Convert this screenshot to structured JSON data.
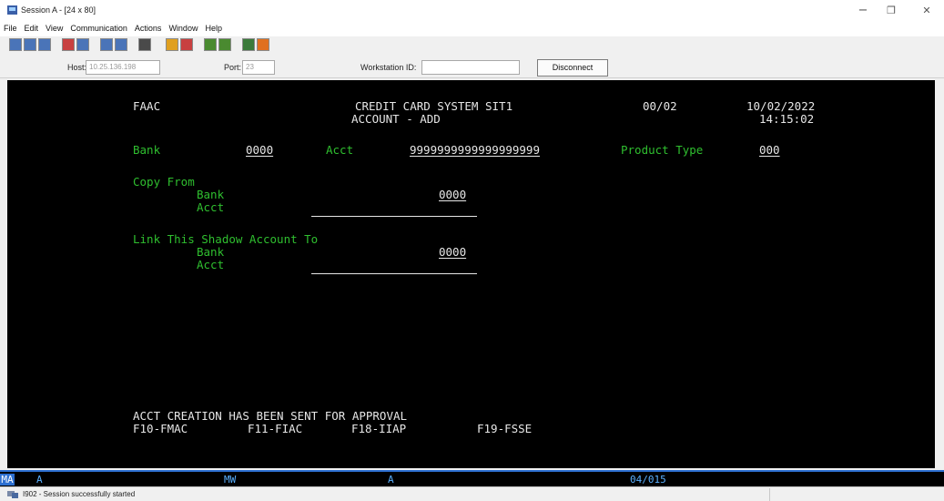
{
  "window": {
    "title": "Session A - [24 x 80]",
    "controls": {
      "minimize": "−",
      "restore": "❐",
      "close": "✕"
    }
  },
  "menu": [
    "File",
    "Edit",
    "View",
    "Communication",
    "Actions",
    "Window",
    "Help"
  ],
  "toolbar": {
    "buttons": [
      {
        "icon": "display-icon",
        "color": "#4a74b8"
      },
      {
        "icon": "copy-icon",
        "color": "#4a74b8"
      },
      {
        "icon": "paste-icon",
        "color": "#4a74b8"
      },
      {
        "icon": "send-icon",
        "color": "#c84040"
      },
      {
        "icon": "receive-icon",
        "color": "#4a74b8"
      },
      {
        "icon": "keypad-icon",
        "color": "#4a74b8"
      },
      {
        "icon": "keyboard-map-icon",
        "color": "#4a74b8"
      },
      {
        "icon": "record-icon",
        "color": "#4a4a4a"
      },
      {
        "icon": "macro-play-icon",
        "color": "#e0a020"
      },
      {
        "icon": "macro-record-icon",
        "color": "#c84040"
      },
      {
        "icon": "chart-icon",
        "color": "#4a8a30"
      },
      {
        "icon": "script-icon",
        "color": "#4a8a30"
      },
      {
        "icon": "globe-icon",
        "color": "#3a7a3a"
      },
      {
        "icon": "help-icon",
        "color": "#e07020"
      }
    ]
  },
  "connection": {
    "host_label": "Host:",
    "host_value": "10.25.136.198",
    "port_label": "Port:",
    "port_value": "23",
    "workstation_label": "Workstation ID:",
    "workstation_value": "",
    "disconnect_label": "Disconnect"
  },
  "terminal": {
    "bg": "#000000",
    "fg_white": "#e6e6e6",
    "fg_green": "#2fbf2f",
    "screen_id": "FAAC",
    "system_title": "CREDIT CARD SYSTEM SIT1",
    "page": "00/02",
    "date": "10/02/2022",
    "subtitle": "ACCOUNT - ADD",
    "time": "14:15:02",
    "bank_label": "Bank",
    "bank_value": "0000",
    "acct_label": "Acct",
    "acct_value": "9999999999999999999",
    "product_type_label": "Product Type",
    "product_type_value": "000",
    "copy_from": {
      "heading": "Copy From",
      "bank_label": "Bank",
      "bank_value": "0000",
      "acct_label": "Acct",
      "acct_value": ""
    },
    "link_shadow": {
      "heading": "Link This Shadow Account To",
      "bank_label": "Bank",
      "bank_value": "0000",
      "acct_label": "Acct",
      "acct_value": ""
    },
    "message": "ACCT CREATION HAS BEEN SENT FOR APPROVAL",
    "function_keys": [
      "F10-FMAC",
      "F11-FIAC",
      "F18-IIAP",
      "F19-FSSE"
    ]
  },
  "oia": {
    "indicator": "MA",
    "field1": "A",
    "field2": "MW",
    "field3": "A",
    "cursor": "04/015",
    "color": "#5ab0ff"
  },
  "status": {
    "message": "I902 - Session successfully started"
  }
}
